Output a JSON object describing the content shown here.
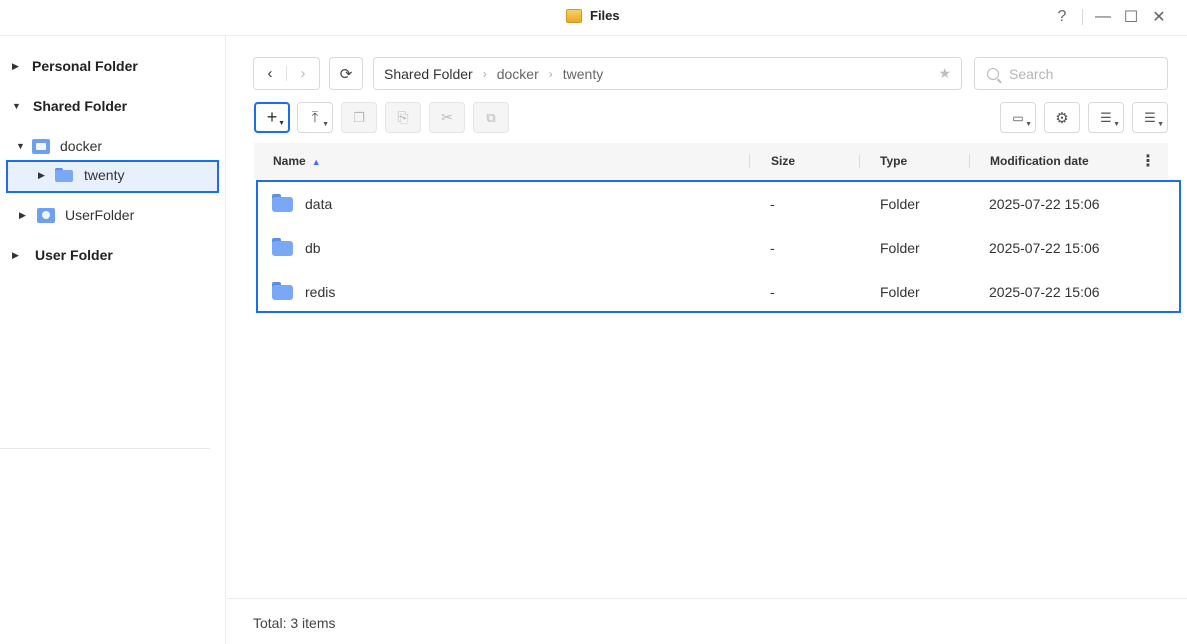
{
  "window": {
    "title": "Files",
    "help": "?",
    "minimize": "—",
    "maximize": "☐",
    "close": "✕"
  },
  "sidebar": {
    "personal_folder": "Personal Folder",
    "shared_folder": "Shared Folder",
    "docker": "docker",
    "twenty": "twenty",
    "user_folder_child": "UserFolder",
    "user_folder": "User Folder"
  },
  "toolbar": {
    "back": "‹",
    "forward": "›",
    "refresh": "⟳",
    "create": "+",
    "upload": "⤒",
    "copy": "❐",
    "paste": "⎘",
    "cut": "✂",
    "rename": "⧉",
    "tools": "▭",
    "settings": "⚙",
    "view": "☰",
    "sort": "☰"
  },
  "path": {
    "crumbs": [
      "Shared Folder",
      "docker",
      "twenty"
    ],
    "separator": "›",
    "star": "★"
  },
  "search": {
    "placeholder": "Search"
  },
  "table": {
    "columns": {
      "name": "Name",
      "size": "Size",
      "type": "Type",
      "modified": "Modification date"
    },
    "sort_indicator": "▲",
    "more": "⋮",
    "rows": [
      {
        "name": "data",
        "size": "-",
        "type": "Folder",
        "modified": "2025-07-22 15:06"
      },
      {
        "name": "db",
        "size": "-",
        "type": "Folder",
        "modified": "2025-07-22 15:06"
      },
      {
        "name": "redis",
        "size": "-",
        "type": "Folder",
        "modified": "2025-07-22 15:06"
      }
    ]
  },
  "status": {
    "total": "Total: 3 items"
  },
  "colors": {
    "accent": "#1a6ee8",
    "folder": "#7aa8f4"
  }
}
